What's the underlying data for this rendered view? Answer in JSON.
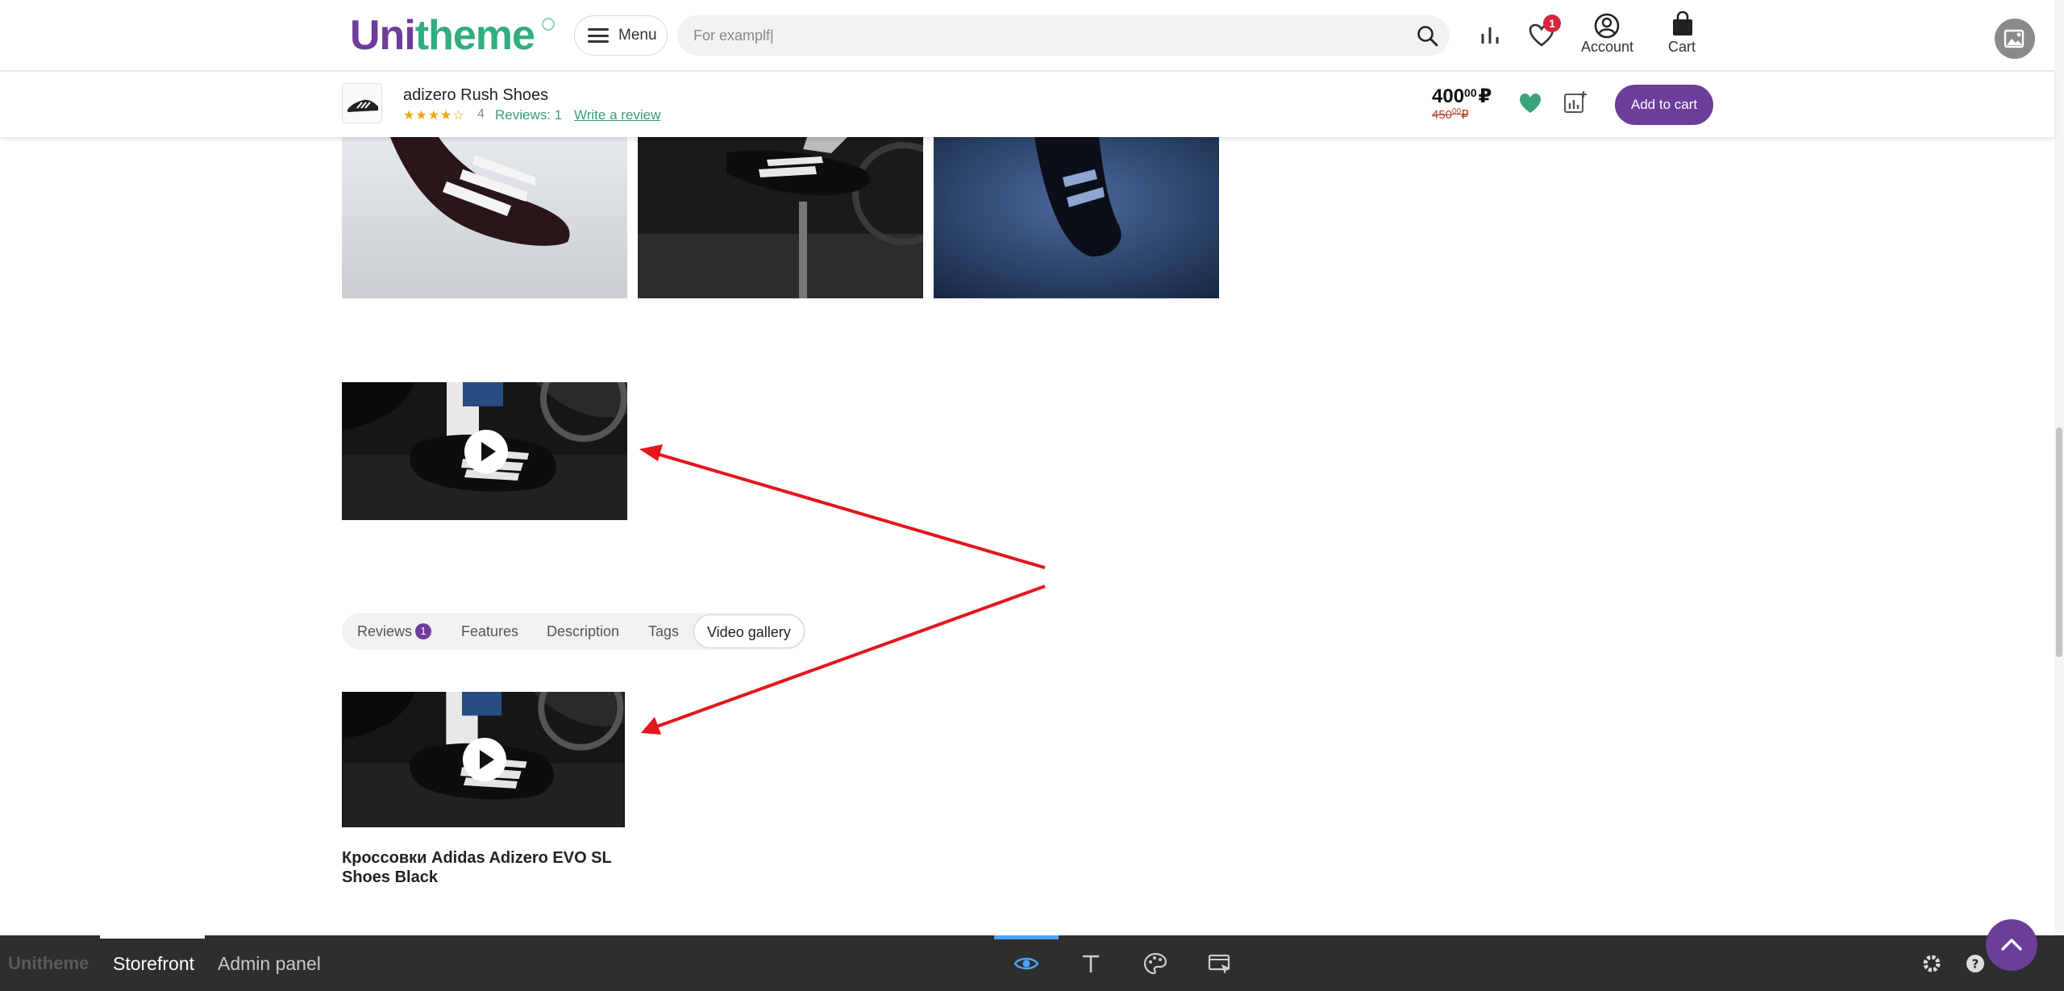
{
  "header": {
    "logo_part1": "Uni",
    "logo_part2": "theme",
    "menu_label": "Menu",
    "search_placeholder": "For examplf|",
    "wishlist_count": "1",
    "account_label": "Account",
    "cart_label": "Cart"
  },
  "product_bar": {
    "name": "adizero Rush Shoes",
    "stars": "★★★★☆",
    "rating": "4",
    "reviews_text": "Reviews: 1",
    "write_review": "Write a review",
    "price_int": "400",
    "price_dec": "00",
    "currency": "₽",
    "old_price_int": "450",
    "old_price_dec": "00",
    "add_to_cart": "Add to cart"
  },
  "tabs": [
    {
      "label": "Reviews",
      "badge": "1"
    },
    {
      "label": "Features"
    },
    {
      "label": "Description"
    },
    {
      "label": "Tags"
    },
    {
      "label": "Video gallery",
      "active": true
    }
  ],
  "video": {
    "title": "Кроссовки Adidas Adizero EVO SL Shoes Black"
  },
  "admin_bar": {
    "logo": "Unitheme",
    "storefront": "Storefront",
    "admin_panel": "Admin panel"
  },
  "colors": {
    "brand_purple": "#6d3d9a",
    "brand_green": "#2fae7e",
    "arrow_red": "#e3161c",
    "badge_red": "#d7263d"
  },
  "icons": [
    "search-icon",
    "bar-chart-icon",
    "heart-icon",
    "account-icon",
    "cart-icon",
    "heart-filled-icon",
    "compare-icon",
    "play-icon",
    "eye-icon",
    "text-icon",
    "palette-icon",
    "layout-icon",
    "gear-icon",
    "help-icon",
    "chevron-up-icon"
  ]
}
